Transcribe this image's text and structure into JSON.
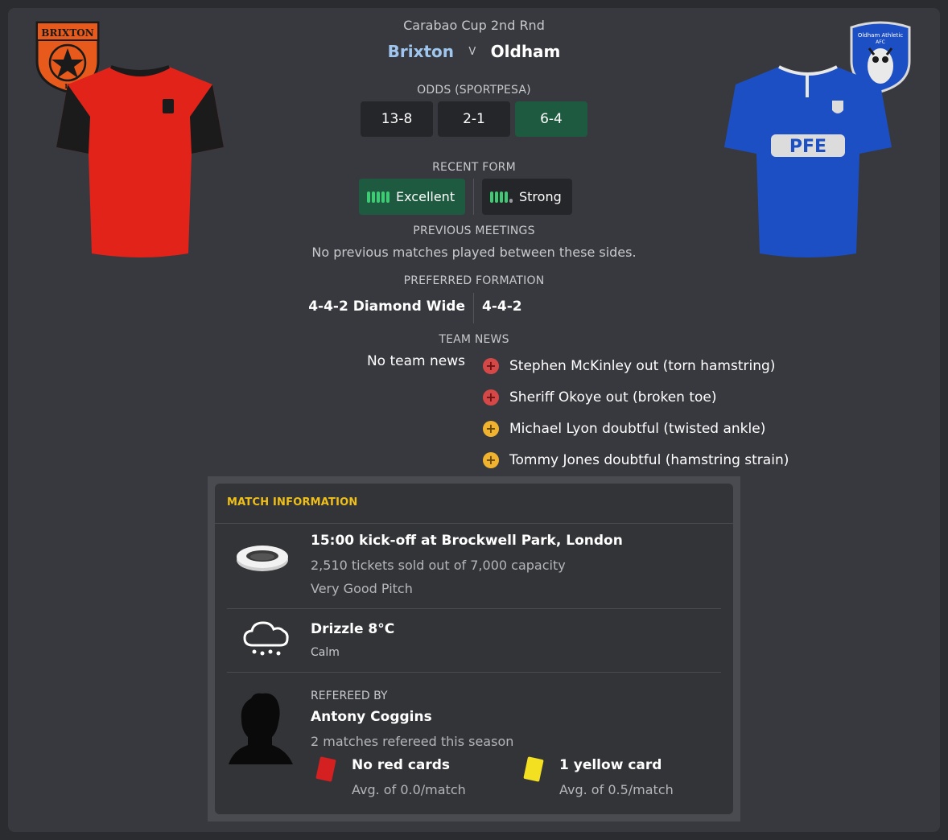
{
  "header": {
    "competition": "Carabao Cup 2nd Rnd",
    "home_team": "Brixton",
    "vs": "V",
    "away_team": "Oldham"
  },
  "home_badge": {
    "text": "BRIXTON",
    "sub": "II",
    "icon": "star-crest-icon"
  },
  "away_badge": {
    "text": "Oldham Athletic",
    "sub": "AFC",
    "icon": "owl-crest-icon"
  },
  "odds": {
    "label": "ODDS (SPORTPESA)",
    "values": [
      "13-8",
      "2-1",
      "6-4"
    ],
    "highlight_index": 2
  },
  "recent_form": {
    "label": "RECENT FORM",
    "home": {
      "text": "Excellent",
      "level": 5
    },
    "away": {
      "text": "Strong",
      "level": 4
    }
  },
  "previous_meetings": {
    "label": "PREVIOUS MEETINGS",
    "text": "No previous matches played between these sides."
  },
  "preferred_formation": {
    "label": "PREFERRED FORMATION",
    "home": "4-4-2 Diamond Wide",
    "away": "4-4-2"
  },
  "team_news": {
    "label": "TEAM NEWS",
    "home_text": "No team news",
    "away_items": [
      {
        "text": "Stephen McKinley out (torn hamstring)",
        "type": "injury",
        "symbol": "+"
      },
      {
        "text": "Sheriff Okoye out (broken toe)",
        "type": "injury",
        "symbol": "+"
      },
      {
        "text": "Michael Lyon doubtful (twisted ankle)",
        "type": "doubt",
        "symbol": "+"
      },
      {
        "text": "Tommy Jones doubtful (hamstring strain)",
        "type": "doubt",
        "symbol": "+"
      }
    ]
  },
  "match_info": {
    "header": "MATCH INFORMATION",
    "venue": {
      "title": "15:00 kick-off at Brockwell Park, London",
      "tickets": "2,510 tickets sold out of 7,000 capacity",
      "pitch": "Very Good Pitch",
      "icon": "stadium-icon"
    },
    "weather": {
      "title": "Drizzle 8°C",
      "wind": "Calm",
      "icon": "drizzle-cloud-icon"
    },
    "referee": {
      "label": "REFEREED BY",
      "name": "Antony Coggins",
      "matches": "2 matches refereed this season",
      "red_cards": "No red cards",
      "red_avg": "Avg. of 0.0/match",
      "yellow_cards": "1 yellow card",
      "yellow_avg": "Avg. of 0.5/match",
      "red_color": "#d42020",
      "yellow_color": "#f2e021"
    }
  },
  "colors": {
    "home_primary": "#e2231a",
    "home_secondary": "#1b1b1b",
    "away_primary": "#1d4fc4",
    "highlight_green": "#1d5a3f",
    "header_gold": "#f0c01a",
    "home_name": "#9fc6ef"
  }
}
